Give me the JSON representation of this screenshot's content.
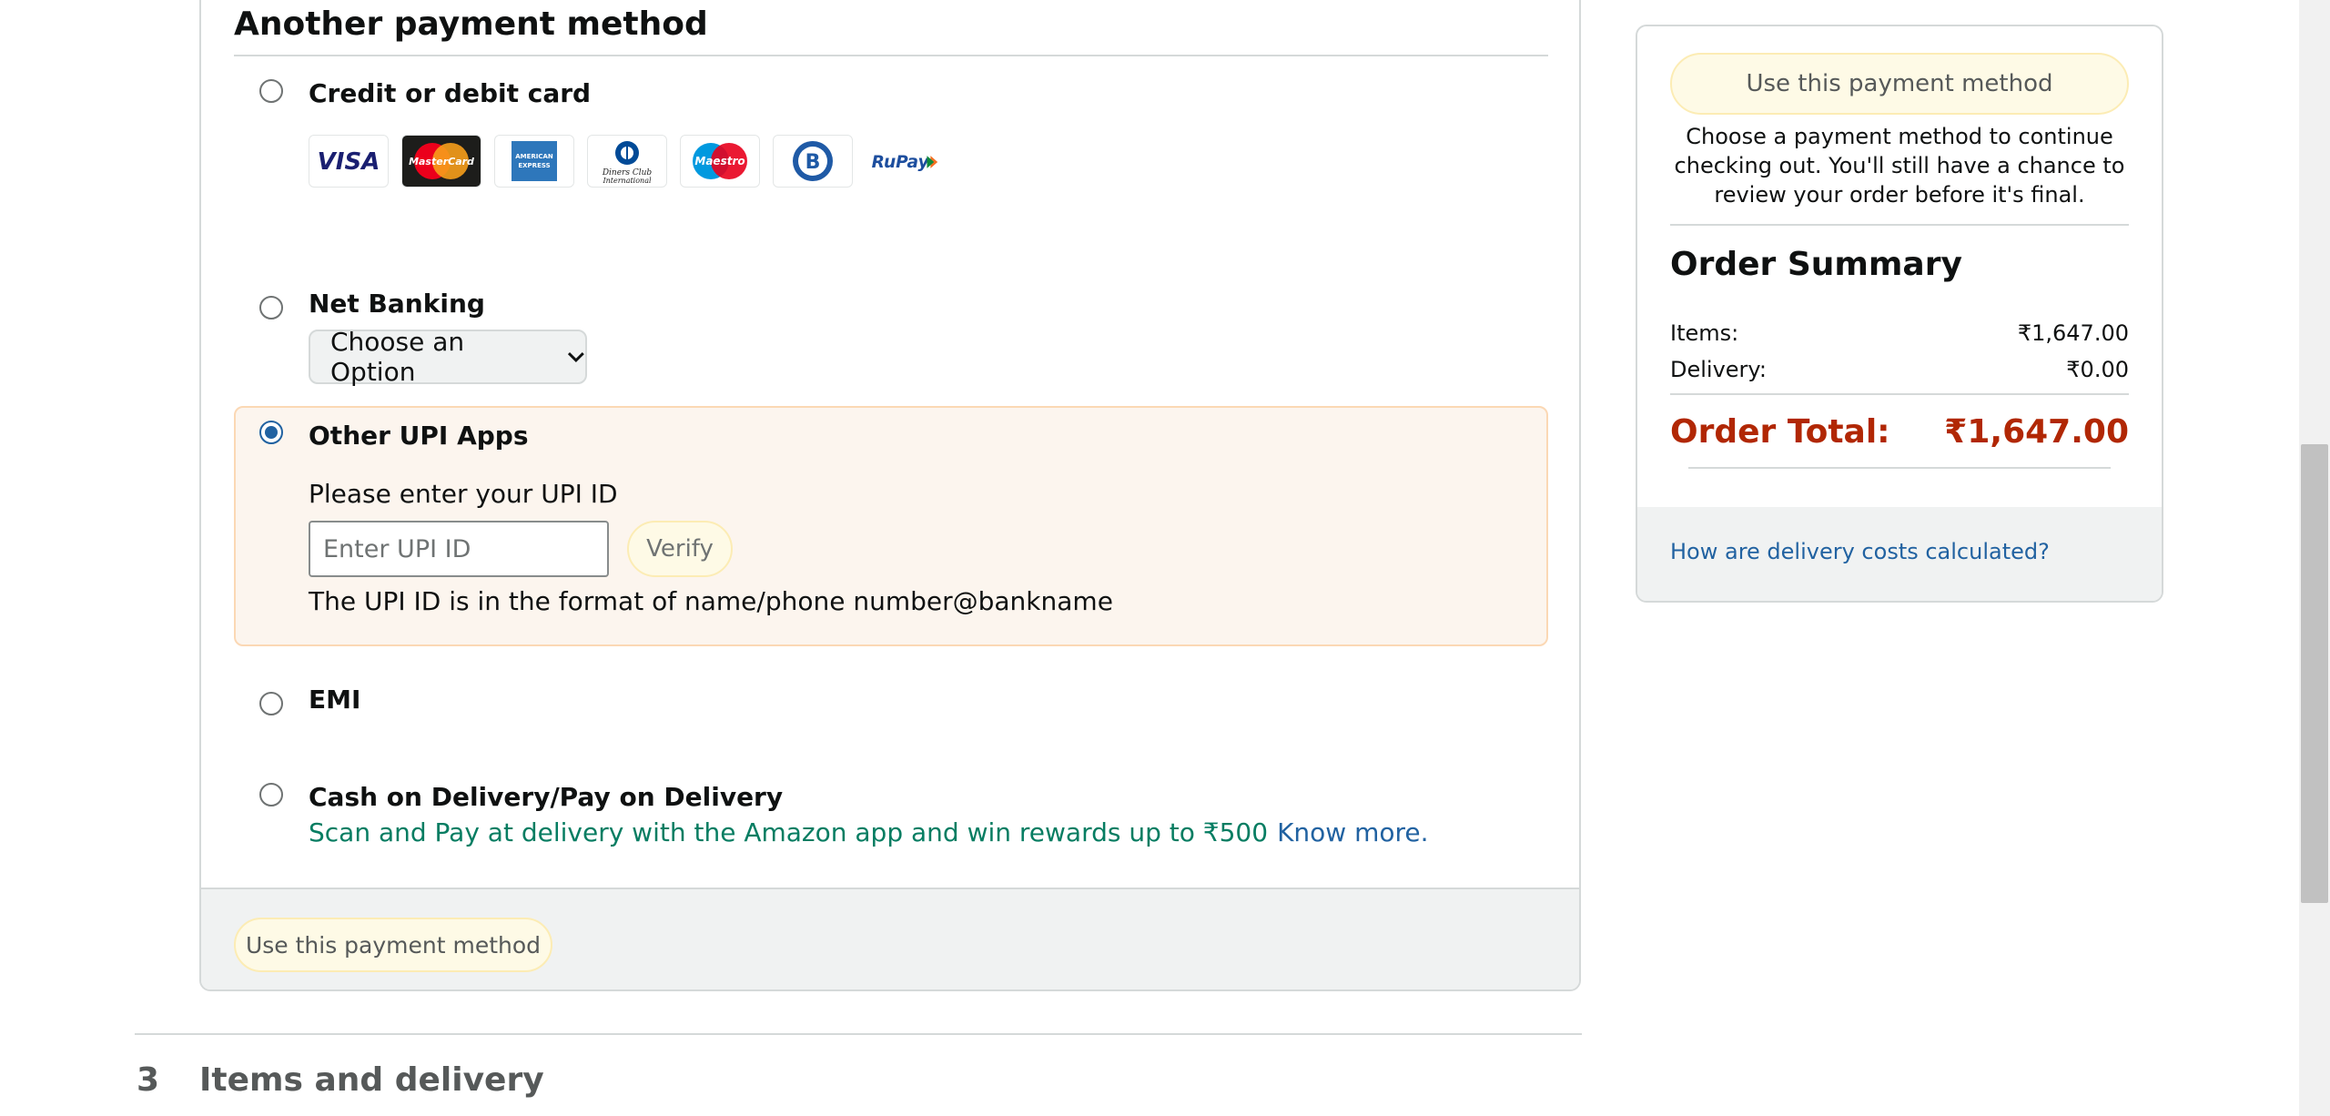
{
  "payment": {
    "section_title": "Another payment method",
    "options": {
      "card": {
        "label": "Credit or debit card",
        "selected": false
      },
      "netbanking": {
        "label": "Net Banking",
        "selected": false,
        "select_value": "Choose an Option"
      },
      "upi": {
        "label": "Other UPI Apps",
        "selected": true,
        "prompt": "Please enter your UPI ID",
        "input_placeholder": "Enter UPI ID",
        "input_value": "",
        "verify_label": "Verify",
        "format_hint": "The UPI ID is in the format of name/phone number@bankname"
      },
      "emi": {
        "label": "EMI",
        "selected": false
      },
      "cod": {
        "label": "Cash on Delivery/Pay on Delivery",
        "selected": false,
        "note": "Scan and Pay at delivery with the Amazon app and win rewards up to ₹500",
        "know_more": "Know more."
      }
    },
    "card_logos": [
      {
        "name": "visa-logo",
        "text": "VISA"
      },
      {
        "name": "mastercard-logo",
        "text": "MasterCard"
      },
      {
        "name": "amex-logo",
        "text": "AMERICAN EXPRESS"
      },
      {
        "name": "diners-club-logo",
        "text": "Diners Club International"
      },
      {
        "name": "maestro-logo",
        "text": "Maestro"
      },
      {
        "name": "bajaj-logo",
        "text": "B"
      },
      {
        "name": "rupay-logo",
        "text": "RuPay"
      }
    ],
    "use_button": "Use this payment method"
  },
  "next_step": {
    "number": "3",
    "title": "Items and delivery"
  },
  "summary": {
    "use_button": "Use this payment method",
    "note": "Choose a payment method to continue checking out. You'll still have a chance to review your order before it's final.",
    "title": "Order Summary",
    "items_label": "Items:",
    "items_value": "₹1,647.00",
    "delivery_label": "Delivery:",
    "delivery_value": "₹0.00",
    "total_label": "Order Total:",
    "total_value": "₹1,647.00",
    "delivery_link": "How are delivery costs calculated?"
  },
  "colors": {
    "accent_link": "#2162a1",
    "total_red": "#b12704",
    "cod_green": "#067d62",
    "upi_highlight_bg": "#fcf5ee"
  }
}
